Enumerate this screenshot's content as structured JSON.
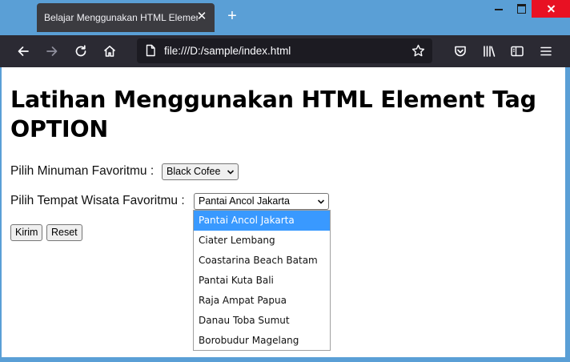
{
  "browser": {
    "tab_title": "Belajar Menggunakan HTML Element Tag OPTION",
    "tab_close_glyph": "✕",
    "new_tab_glyph": "+",
    "url": "file:///D:/sample/index.html"
  },
  "page": {
    "heading": "Latihan Menggunakan HTML Element Tag OPTION",
    "drink": {
      "label": "Pilih Minuman Favoritmu :",
      "selected": "Black Cofee"
    },
    "place": {
      "label": "Pilih Tempat Wisata Favoritmu :",
      "selected": "Pantai Ancol Jakarta",
      "options": [
        "Pantai Ancol Jakarta",
        "Ciater Lembang",
        "Coastarina Beach Batam",
        "Pantai Kuta Bali",
        "Raja Ampat Papua",
        "Danau Toba Sumut",
        "Borobudur Magelang"
      ],
      "highlighted_index": 0
    },
    "submit_label": "Kirim",
    "reset_label": "Reset"
  },
  "colors": {
    "frame": "#5a9fd6",
    "toolbar": "#2b2a33",
    "highlight": "#3999ff",
    "close_red": "#e81123"
  }
}
